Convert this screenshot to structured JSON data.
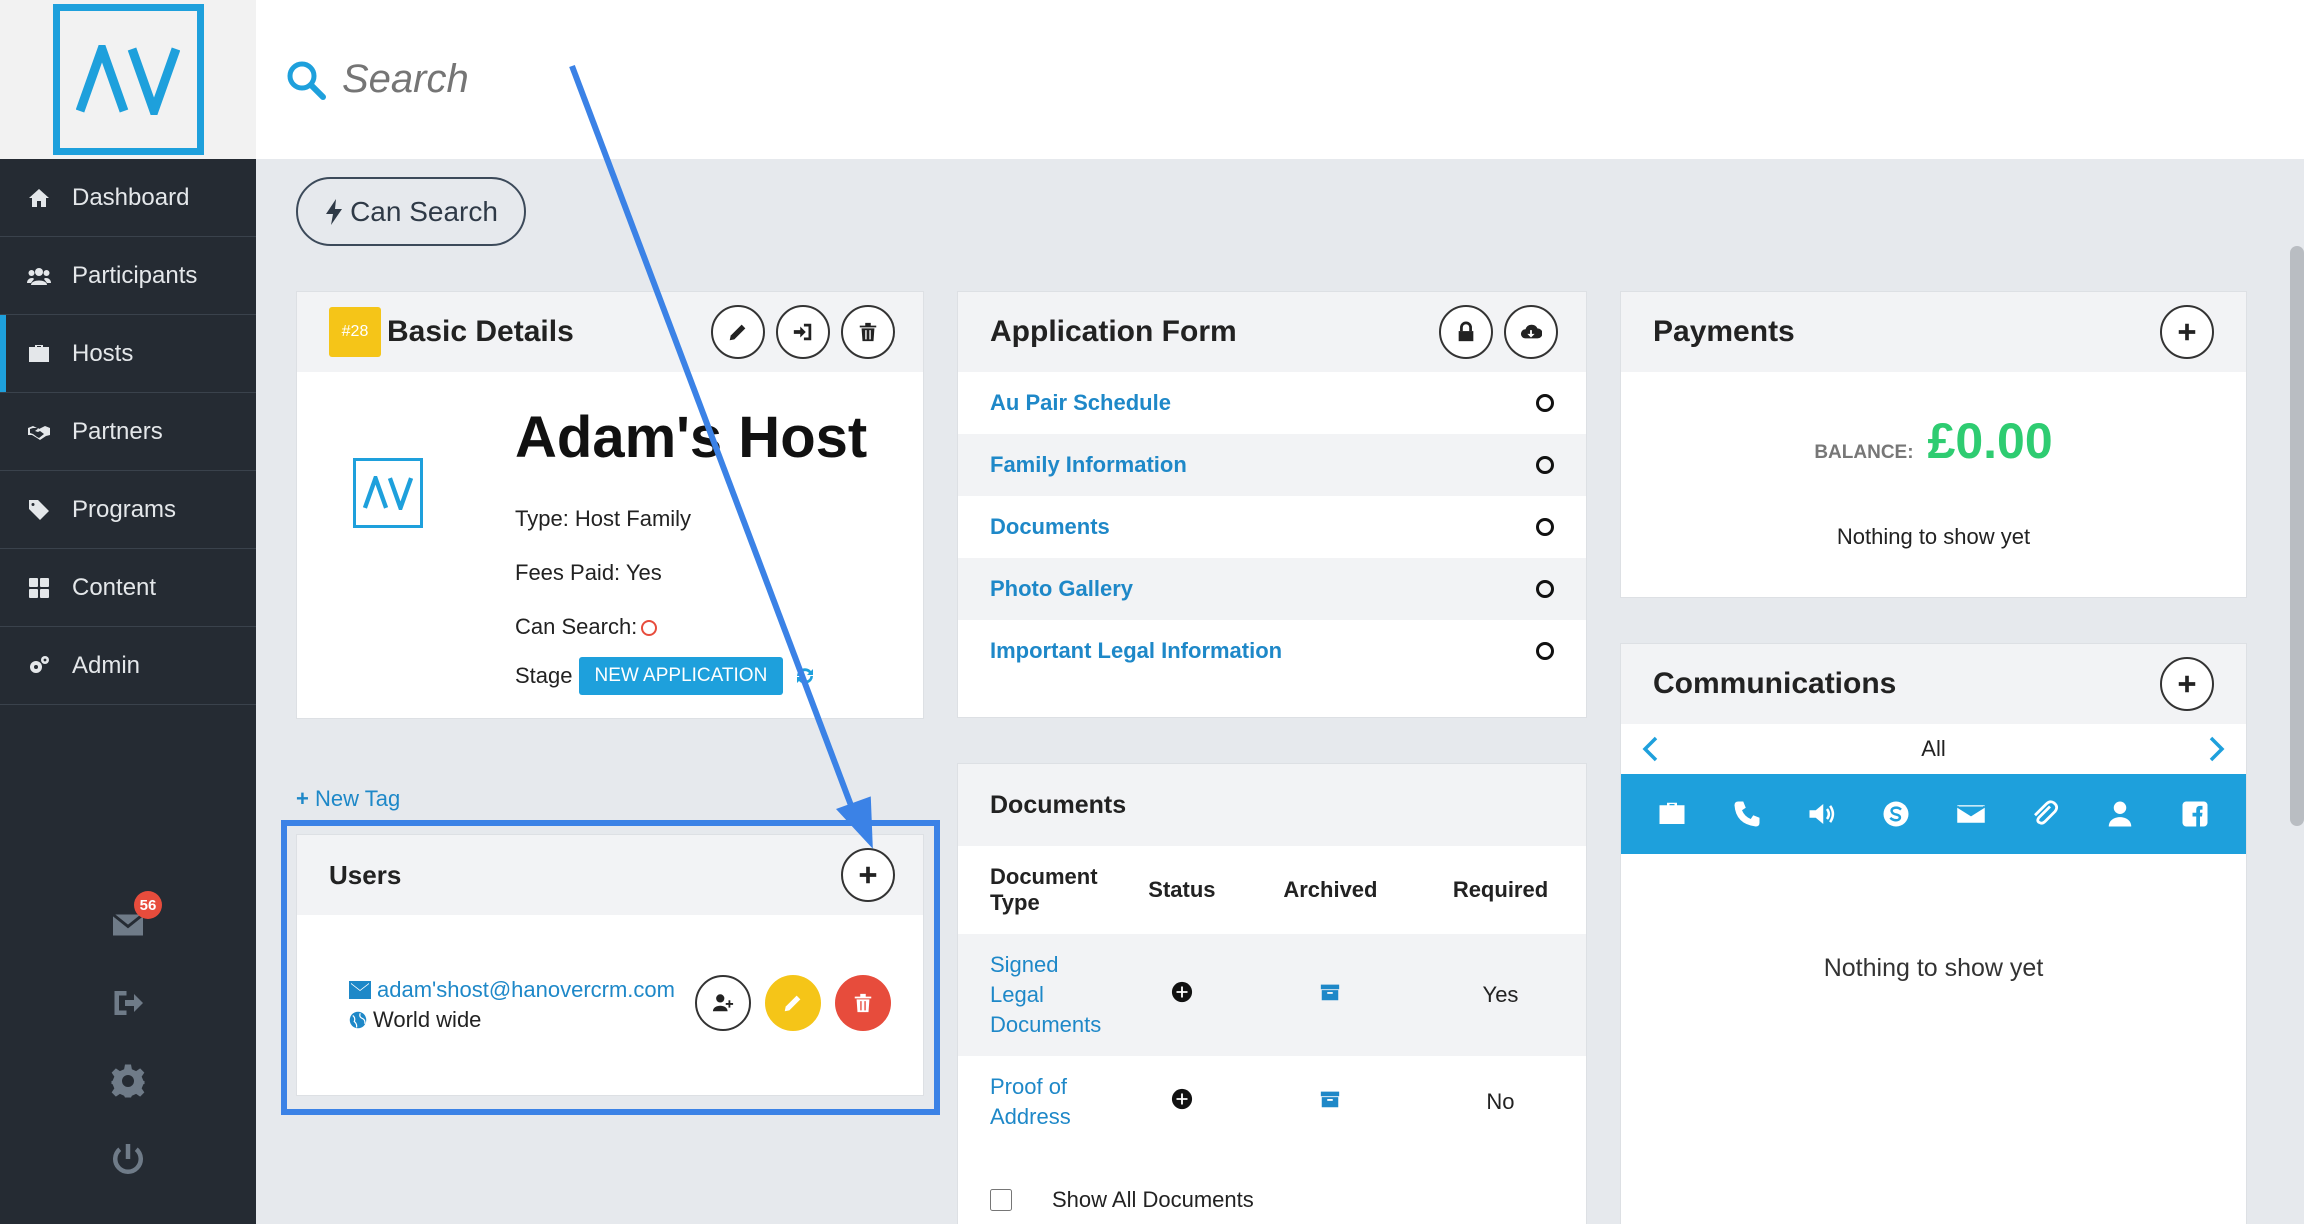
{
  "sidebar": {
    "items": [
      {
        "label": "Dashboard",
        "icon": "home-icon"
      },
      {
        "label": "Participants",
        "icon": "users-icon"
      },
      {
        "label": "Hosts",
        "icon": "briefcase-icon"
      },
      {
        "label": "Partners",
        "icon": "handshake-icon"
      },
      {
        "label": "Programs",
        "icon": "tag-icon"
      },
      {
        "label": "Content",
        "icon": "grid-icon"
      },
      {
        "label": "Admin",
        "icon": "gears-icon"
      }
    ],
    "active": "Hosts",
    "mail_count": "56"
  },
  "search": {
    "placeholder": "Search"
  },
  "can_search_button": "Can Search",
  "basic_details": {
    "badge": "#28",
    "title": "Basic Details",
    "host_name": "Adam's Host",
    "type": "Type: Host Family",
    "fees_paid": "Fees Paid: Yes",
    "can_search": "Can Search:",
    "stage_label": "Stage",
    "stage_value": "NEW APPLICATION"
  },
  "application_form": {
    "title": "Application Form",
    "rows": [
      "Au Pair Schedule",
      "Family Information",
      "Documents",
      "Photo Gallery",
      "Important Legal Information"
    ]
  },
  "documents": {
    "title": "Documents",
    "headers": [
      "Document Type",
      "Status",
      "Archived",
      "Required"
    ],
    "rows": [
      {
        "type": "Signed Legal Documents",
        "required": "Yes"
      },
      {
        "type": "Proof of Address",
        "required": "No"
      }
    ],
    "show_all": "Show All Documents"
  },
  "payments": {
    "title": "Payments",
    "balance_label": "BALANCE:",
    "balance_value": "£0.00",
    "empty": "Nothing to show yet"
  },
  "communications": {
    "title": "Communications",
    "filter": "All",
    "icons": [
      "briefcase-icon",
      "phone-icon",
      "volume-icon",
      "skype-icon",
      "envelope-icon",
      "paperclip-icon",
      "user-icon",
      "facebook-icon"
    ],
    "empty": "Nothing to show yet"
  },
  "new_tag": "New Tag",
  "users": {
    "title": "Users",
    "email": "adam'shost@hanovercrm.com",
    "region": "World wide"
  },
  "colors": {
    "accent": "#1ea0dc",
    "sidebar": "#252b33",
    "highlight": "#3b82e6",
    "balance": "#2ecc71",
    "delete": "#e74c3c",
    "edit": "#f5c518"
  }
}
